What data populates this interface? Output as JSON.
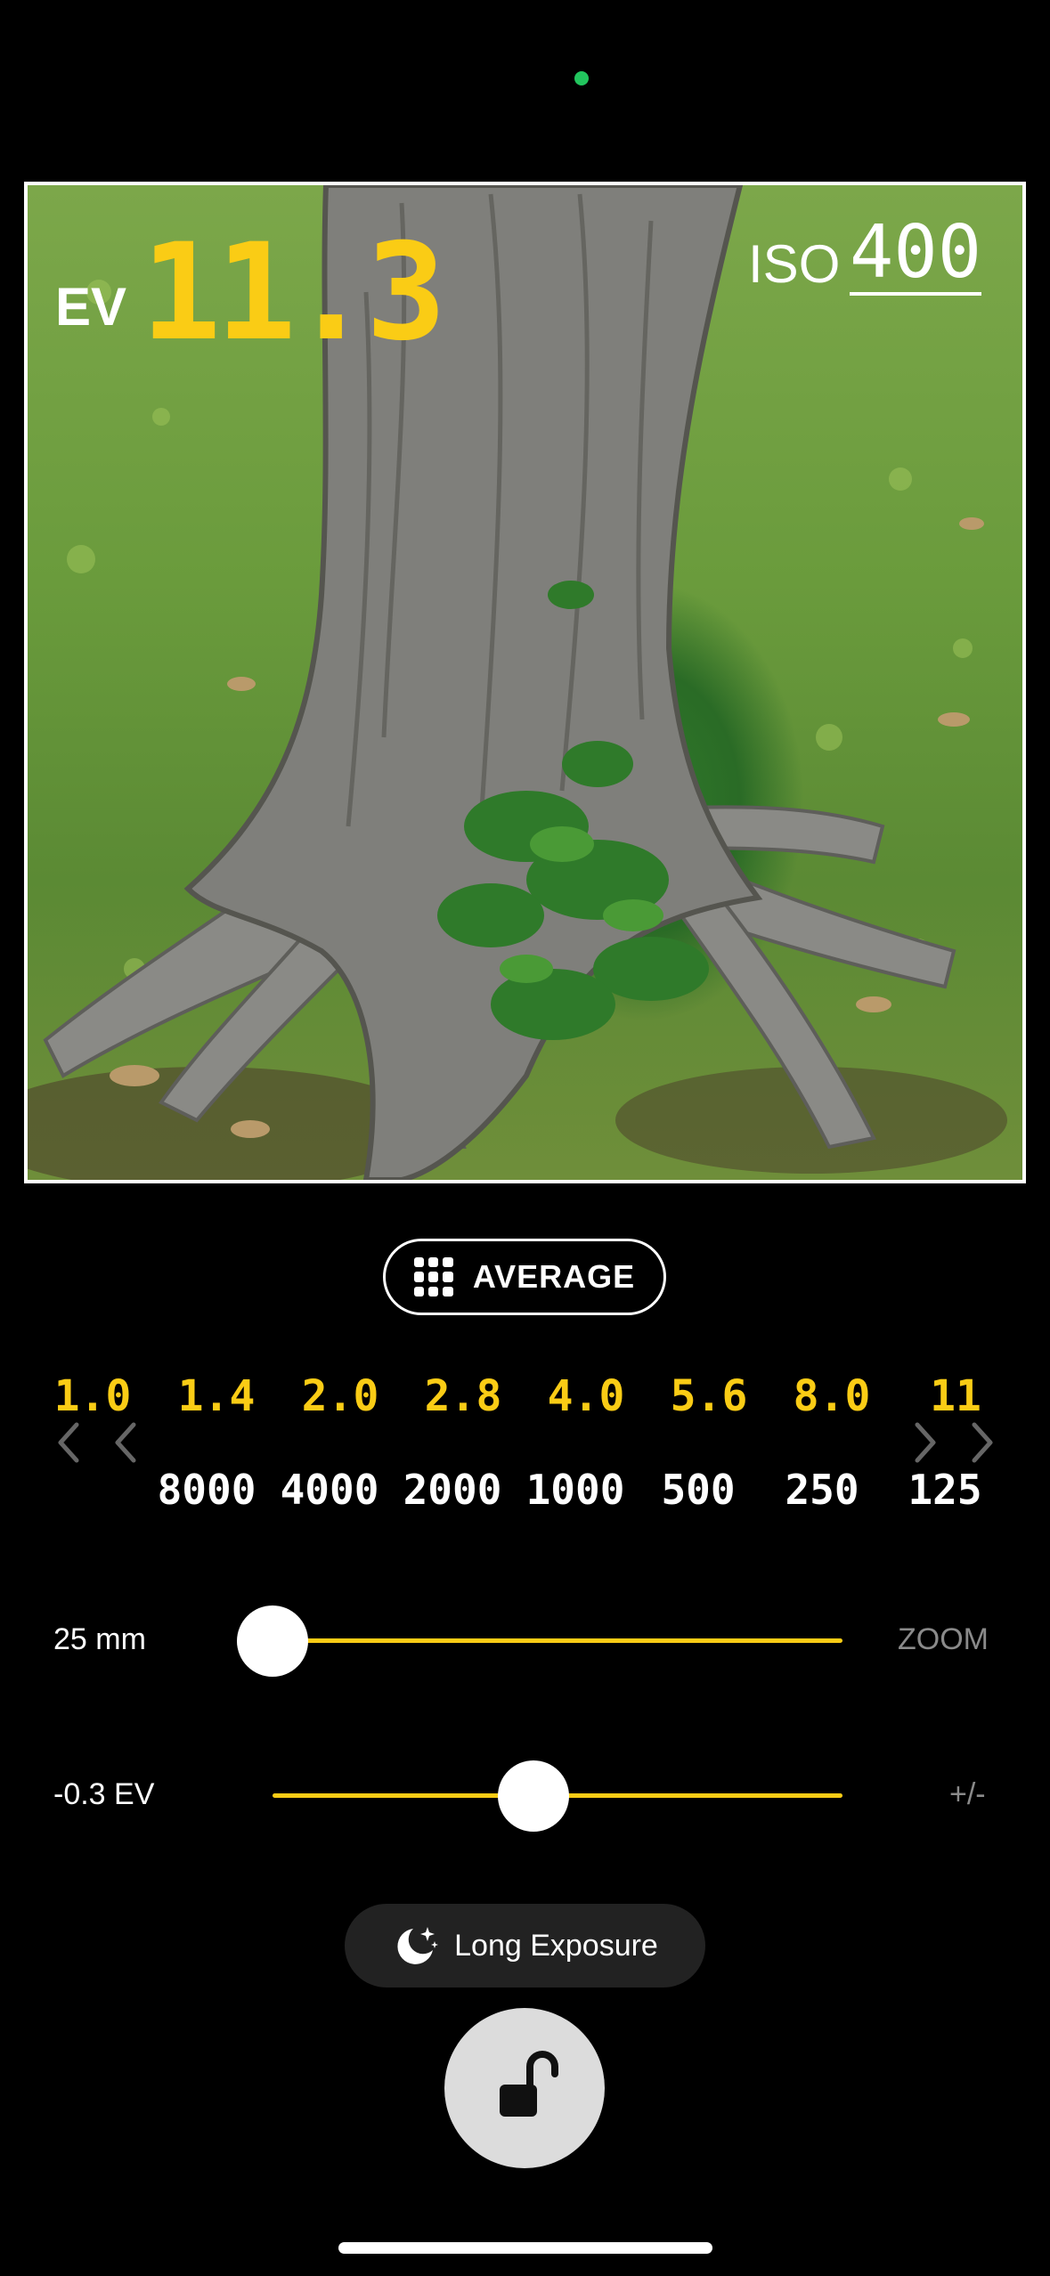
{
  "meter": {
    "ev_label": "EV",
    "ev_value": "11.3",
    "iso_label": "ISO",
    "iso_value": "400"
  },
  "metering": {
    "label": "AVERAGE",
    "icon": "grid-icon"
  },
  "apertures": [
    "1.0",
    "1.4",
    "2.0",
    "2.8",
    "4.0",
    "5.6",
    "8.0",
    "11"
  ],
  "shutter_speeds": [
    "8000",
    "4000",
    "2000",
    "1000",
    "500",
    "250",
    "125"
  ],
  "zoom": {
    "value_label": "25 mm",
    "right_label": "ZOOM",
    "level": 0.0
  },
  "exposure_comp": {
    "value_label": "-0.3 EV",
    "right_label": "+/-",
    "level": 0.45
  },
  "long_exposure": {
    "label": "Long Exposure",
    "icon": "moon-stars-icon"
  },
  "lock": {
    "icon": "unlock-icon"
  },
  "colors": {
    "accent": "#facc15",
    "indicator": "#22c55e",
    "background": "#000000"
  }
}
